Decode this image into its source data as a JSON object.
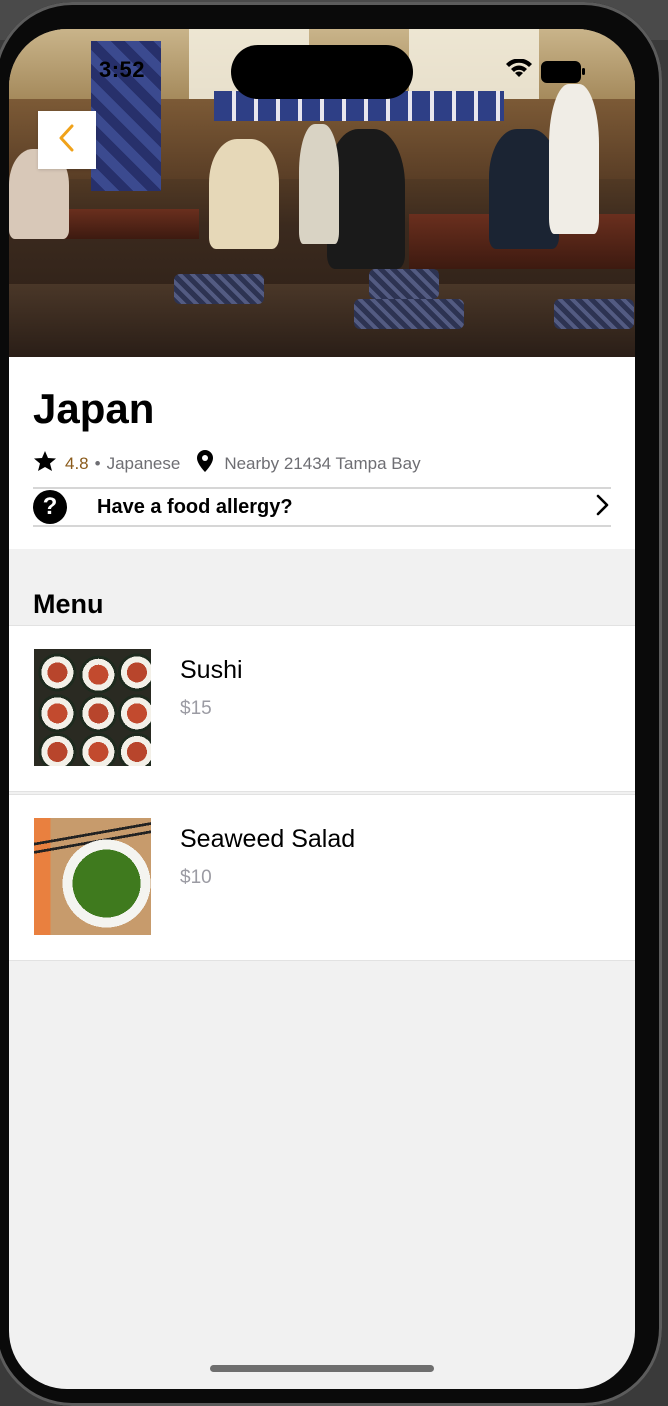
{
  "status_bar": {
    "time": "3:52"
  },
  "restaurant": {
    "name": "Japan",
    "rating": "4.8",
    "separator": "•",
    "cuisine": "Japanese",
    "location": "Nearby 21434 Tampa Bay"
  },
  "allergy": {
    "label": "Have a food allergy?"
  },
  "menu": {
    "heading": "Menu",
    "items": [
      {
        "name": "Sushi",
        "price": "$15"
      },
      {
        "name": "Seaweed Salad",
        "price": "$10"
      }
    ]
  },
  "colors": {
    "accent": "#f0a21a",
    "price": "#9b9ba3",
    "rating": "#8a5a1a",
    "background": "#f1f1f1"
  },
  "icons": [
    "chevron-left-icon",
    "star-icon",
    "location-pin-icon",
    "question-icon",
    "chevron-right-icon",
    "wifi-icon",
    "battery-icon"
  ]
}
